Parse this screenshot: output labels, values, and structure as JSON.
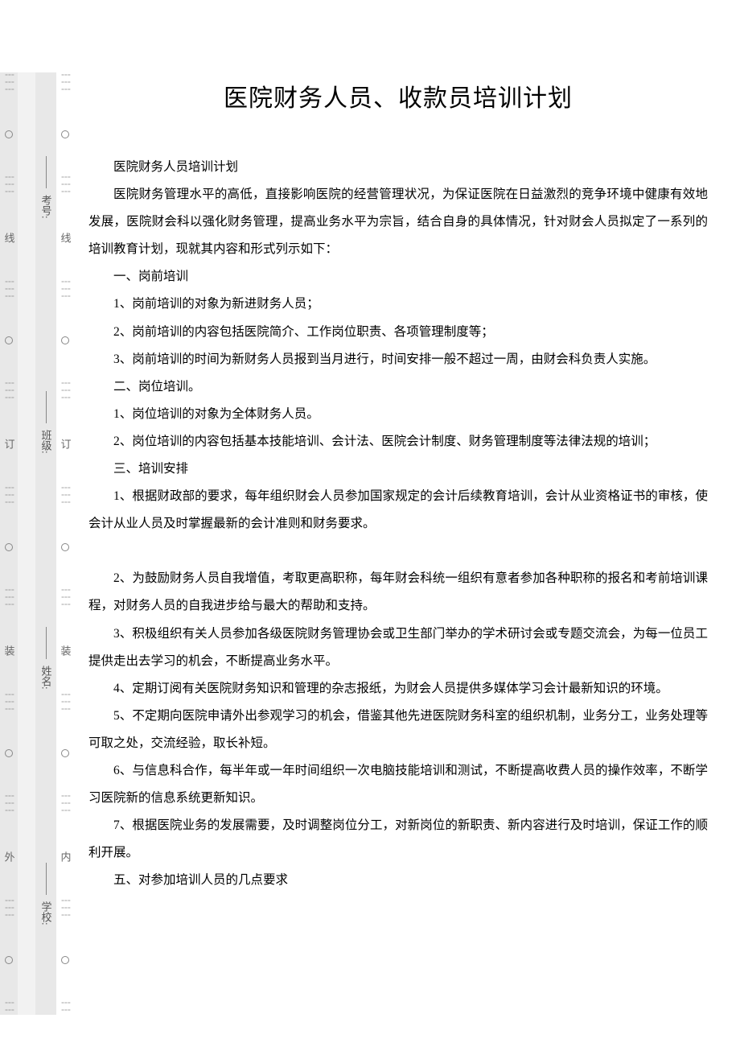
{
  "title": "医院财务人员、收款员培训计划",
  "subtitle": "医院财务人员培训计划",
  "intro": "医院财务管理水平的高低，直接影响医院的经营管理状况，为保证医院在日益激烈的竞争环境中健康有效地发展，医院财会科以强化财务管理，提高业务水平为宗旨，结合自身的具体情况，针对财会人员拟定了一系列的培训教育计划，现就其内容和形式列示如下：",
  "sections": {
    "s1": {
      "header": "一、岗前培训",
      "items": [
        "1、岗前培训的对象为新进财务人员；",
        "2、岗前培训的内容包括医院简介、工作岗位职责、各项管理制度等；",
        "3、岗前培训的时间为新财务人员报到当月进行，时间安排一般不超过一周，由财会科负责人实施。"
      ]
    },
    "s2": {
      "header": "二、岗位培训。",
      "items": [
        "1、岗位培训的对象为全体财务人员。",
        "2、岗位培训的内容包括基本技能培训、会计法、医院会计制度、财务管理制度等法律法规的培训；"
      ]
    },
    "s3": {
      "header": "三、培训安排",
      "items_a": [
        "1、根据财政部的要求，每年组织财会人员参加国家规定的会计后续教育培训，会计从业资格证书的审核，使会计从业人员及时掌握最新的会计准则和财务要求。"
      ],
      "items_b": [
        "2、为鼓励财务人员自我增值，考取更高职称，每年财会科统一组织有意者参加各种职称的报名和考前培训课程，对财务人员的自我进步给与最大的帮助和支持。",
        "3、积极组织有关人员参加各级医院财务管理协会或卫生部门举办的学术研讨会或专题交流会，为每一位员工提供走出去学习的机会，不断提高业务水平。",
        "4、定期订阅有关医院财务知识和管理的杂志报纸，为财会人员提供多媒体学习会计最新知识的环境。",
        "5、不定期向医院申请外出参观学习的机会，借鉴其他先进医院财务科室的组织机制，业务分工，业务处理等可取之处，交流经验，取长补短。",
        "6、与信息科合作，每半年或一年时间组织一次电脑技能培训和测试，不断提高收费人员的操作效率，不断学习医院新的信息系统更新知识。",
        "7、根据医院业务的发展需要，及时调整岗位分工，对新岗位的新职责、新内容进行及时培训，保证工作的顺利开展。"
      ]
    },
    "s5": {
      "header": "五、对参加培训人员的几点要求"
    }
  },
  "margin": {
    "labels": [
      "考号:",
      "班级:",
      "姓名:",
      "学校:"
    ],
    "outer_chars": [
      "线",
      "订",
      "装",
      "外"
    ],
    "inner_chars": [
      "线",
      "订",
      "装",
      "内"
    ]
  }
}
